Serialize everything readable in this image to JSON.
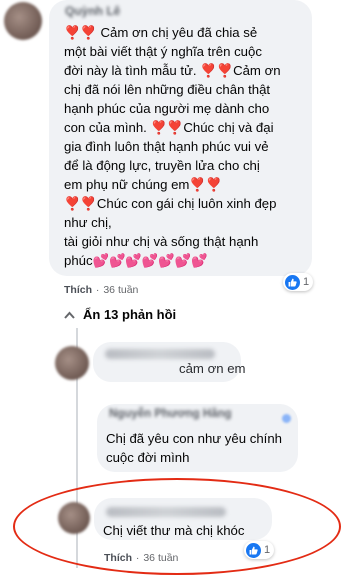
{
  "main_comment": {
    "author": "Quỳnh Lê",
    "lines": [
      "❣️❣️ Cảm ơn chị yêu đã chia sẻ",
      "một bài viết thật ý nghĩa trên cuộc",
      "đời này là tình mẫu tử. ❣️❣️Cảm ơn",
      "chị đã nói lên những điều chân thật",
      "hạnh phúc của người mẹ dành cho",
      "con của mình. ❣️❣️Chúc chị và đại",
      "gia đình luôn thật hạnh phúc vui vẻ",
      "để là động lực, truyền lửa cho chị",
      "em phụ nữ chúng em❣️❣️",
      "❣️❣️Chúc con gái chị luôn xinh đẹp",
      "như chị,",
      "tài giỏi như chị và sống thật hạnh",
      "phúc💕💕💕💕💕💕💕"
    ],
    "like_label": "Thích",
    "time": "36 tuần",
    "reaction_count": "1"
  },
  "replies_toggle": {
    "label": "Ẩn 13 phản hồi"
  },
  "reply1": {
    "text": "cảm ơn em"
  },
  "reply2": {
    "author": "Nguyễn Phương Hằng",
    "lines": [
      "Chị đã yêu con như yêu chính",
      "cuộc đời mình"
    ]
  },
  "reply3": {
    "text": "Chị viết thư mà chị khóc",
    "like_label": "Thích",
    "time": "36 tuần",
    "reaction_count": "1"
  },
  "colors": {
    "bubble": "#f0f2f5",
    "like_blue": "#1877f2",
    "highlight_red": "#e32b14"
  }
}
